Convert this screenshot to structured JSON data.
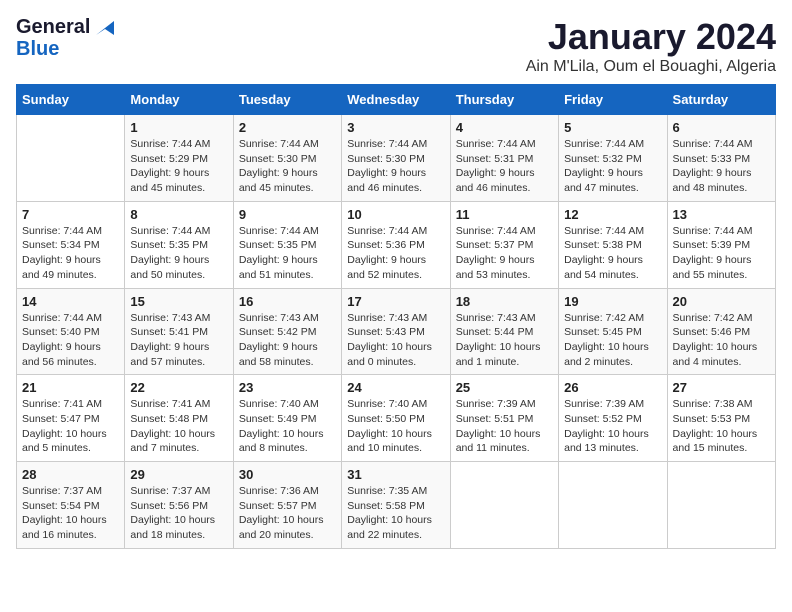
{
  "logo": {
    "line1": "General",
    "line2": "Blue"
  },
  "title": "January 2024",
  "subtitle": "Ain M'Lila, Oum el Bouaghi, Algeria",
  "days_of_week": [
    "Sunday",
    "Monday",
    "Tuesday",
    "Wednesday",
    "Thursday",
    "Friday",
    "Saturday"
  ],
  "weeks": [
    [
      {
        "num": "",
        "sunrise": "",
        "sunset": "",
        "daylight": ""
      },
      {
        "num": "1",
        "sunrise": "Sunrise: 7:44 AM",
        "sunset": "Sunset: 5:29 PM",
        "daylight": "Daylight: 9 hours and 45 minutes."
      },
      {
        "num": "2",
        "sunrise": "Sunrise: 7:44 AM",
        "sunset": "Sunset: 5:30 PM",
        "daylight": "Daylight: 9 hours and 45 minutes."
      },
      {
        "num": "3",
        "sunrise": "Sunrise: 7:44 AM",
        "sunset": "Sunset: 5:30 PM",
        "daylight": "Daylight: 9 hours and 46 minutes."
      },
      {
        "num": "4",
        "sunrise": "Sunrise: 7:44 AM",
        "sunset": "Sunset: 5:31 PM",
        "daylight": "Daylight: 9 hours and 46 minutes."
      },
      {
        "num": "5",
        "sunrise": "Sunrise: 7:44 AM",
        "sunset": "Sunset: 5:32 PM",
        "daylight": "Daylight: 9 hours and 47 minutes."
      },
      {
        "num": "6",
        "sunrise": "Sunrise: 7:44 AM",
        "sunset": "Sunset: 5:33 PM",
        "daylight": "Daylight: 9 hours and 48 minutes."
      }
    ],
    [
      {
        "num": "7",
        "sunrise": "Sunrise: 7:44 AM",
        "sunset": "Sunset: 5:34 PM",
        "daylight": "Daylight: 9 hours and 49 minutes."
      },
      {
        "num": "8",
        "sunrise": "Sunrise: 7:44 AM",
        "sunset": "Sunset: 5:35 PM",
        "daylight": "Daylight: 9 hours and 50 minutes."
      },
      {
        "num": "9",
        "sunrise": "Sunrise: 7:44 AM",
        "sunset": "Sunset: 5:35 PM",
        "daylight": "Daylight: 9 hours and 51 minutes."
      },
      {
        "num": "10",
        "sunrise": "Sunrise: 7:44 AM",
        "sunset": "Sunset: 5:36 PM",
        "daylight": "Daylight: 9 hours and 52 minutes."
      },
      {
        "num": "11",
        "sunrise": "Sunrise: 7:44 AM",
        "sunset": "Sunset: 5:37 PM",
        "daylight": "Daylight: 9 hours and 53 minutes."
      },
      {
        "num": "12",
        "sunrise": "Sunrise: 7:44 AM",
        "sunset": "Sunset: 5:38 PM",
        "daylight": "Daylight: 9 hours and 54 minutes."
      },
      {
        "num": "13",
        "sunrise": "Sunrise: 7:44 AM",
        "sunset": "Sunset: 5:39 PM",
        "daylight": "Daylight: 9 hours and 55 minutes."
      }
    ],
    [
      {
        "num": "14",
        "sunrise": "Sunrise: 7:44 AM",
        "sunset": "Sunset: 5:40 PM",
        "daylight": "Daylight: 9 hours and 56 minutes."
      },
      {
        "num": "15",
        "sunrise": "Sunrise: 7:43 AM",
        "sunset": "Sunset: 5:41 PM",
        "daylight": "Daylight: 9 hours and 57 minutes."
      },
      {
        "num": "16",
        "sunrise": "Sunrise: 7:43 AM",
        "sunset": "Sunset: 5:42 PM",
        "daylight": "Daylight: 9 hours and 58 minutes."
      },
      {
        "num": "17",
        "sunrise": "Sunrise: 7:43 AM",
        "sunset": "Sunset: 5:43 PM",
        "daylight": "Daylight: 10 hours and 0 minutes."
      },
      {
        "num": "18",
        "sunrise": "Sunrise: 7:43 AM",
        "sunset": "Sunset: 5:44 PM",
        "daylight": "Daylight: 10 hours and 1 minute."
      },
      {
        "num": "19",
        "sunrise": "Sunrise: 7:42 AM",
        "sunset": "Sunset: 5:45 PM",
        "daylight": "Daylight: 10 hours and 2 minutes."
      },
      {
        "num": "20",
        "sunrise": "Sunrise: 7:42 AM",
        "sunset": "Sunset: 5:46 PM",
        "daylight": "Daylight: 10 hours and 4 minutes."
      }
    ],
    [
      {
        "num": "21",
        "sunrise": "Sunrise: 7:41 AM",
        "sunset": "Sunset: 5:47 PM",
        "daylight": "Daylight: 10 hours and 5 minutes."
      },
      {
        "num": "22",
        "sunrise": "Sunrise: 7:41 AM",
        "sunset": "Sunset: 5:48 PM",
        "daylight": "Daylight: 10 hours and 7 minutes."
      },
      {
        "num": "23",
        "sunrise": "Sunrise: 7:40 AM",
        "sunset": "Sunset: 5:49 PM",
        "daylight": "Daylight: 10 hours and 8 minutes."
      },
      {
        "num": "24",
        "sunrise": "Sunrise: 7:40 AM",
        "sunset": "Sunset: 5:50 PM",
        "daylight": "Daylight: 10 hours and 10 minutes."
      },
      {
        "num": "25",
        "sunrise": "Sunrise: 7:39 AM",
        "sunset": "Sunset: 5:51 PM",
        "daylight": "Daylight: 10 hours and 11 minutes."
      },
      {
        "num": "26",
        "sunrise": "Sunrise: 7:39 AM",
        "sunset": "Sunset: 5:52 PM",
        "daylight": "Daylight: 10 hours and 13 minutes."
      },
      {
        "num": "27",
        "sunrise": "Sunrise: 7:38 AM",
        "sunset": "Sunset: 5:53 PM",
        "daylight": "Daylight: 10 hours and 15 minutes."
      }
    ],
    [
      {
        "num": "28",
        "sunrise": "Sunrise: 7:37 AM",
        "sunset": "Sunset: 5:54 PM",
        "daylight": "Daylight: 10 hours and 16 minutes."
      },
      {
        "num": "29",
        "sunrise": "Sunrise: 7:37 AM",
        "sunset": "Sunset: 5:56 PM",
        "daylight": "Daylight: 10 hours and 18 minutes."
      },
      {
        "num": "30",
        "sunrise": "Sunrise: 7:36 AM",
        "sunset": "Sunset: 5:57 PM",
        "daylight": "Daylight: 10 hours and 20 minutes."
      },
      {
        "num": "31",
        "sunrise": "Sunrise: 7:35 AM",
        "sunset": "Sunset: 5:58 PM",
        "daylight": "Daylight: 10 hours and 22 minutes."
      },
      {
        "num": "",
        "sunrise": "",
        "sunset": "",
        "daylight": ""
      },
      {
        "num": "",
        "sunrise": "",
        "sunset": "",
        "daylight": ""
      },
      {
        "num": "",
        "sunrise": "",
        "sunset": "",
        "daylight": ""
      }
    ]
  ]
}
